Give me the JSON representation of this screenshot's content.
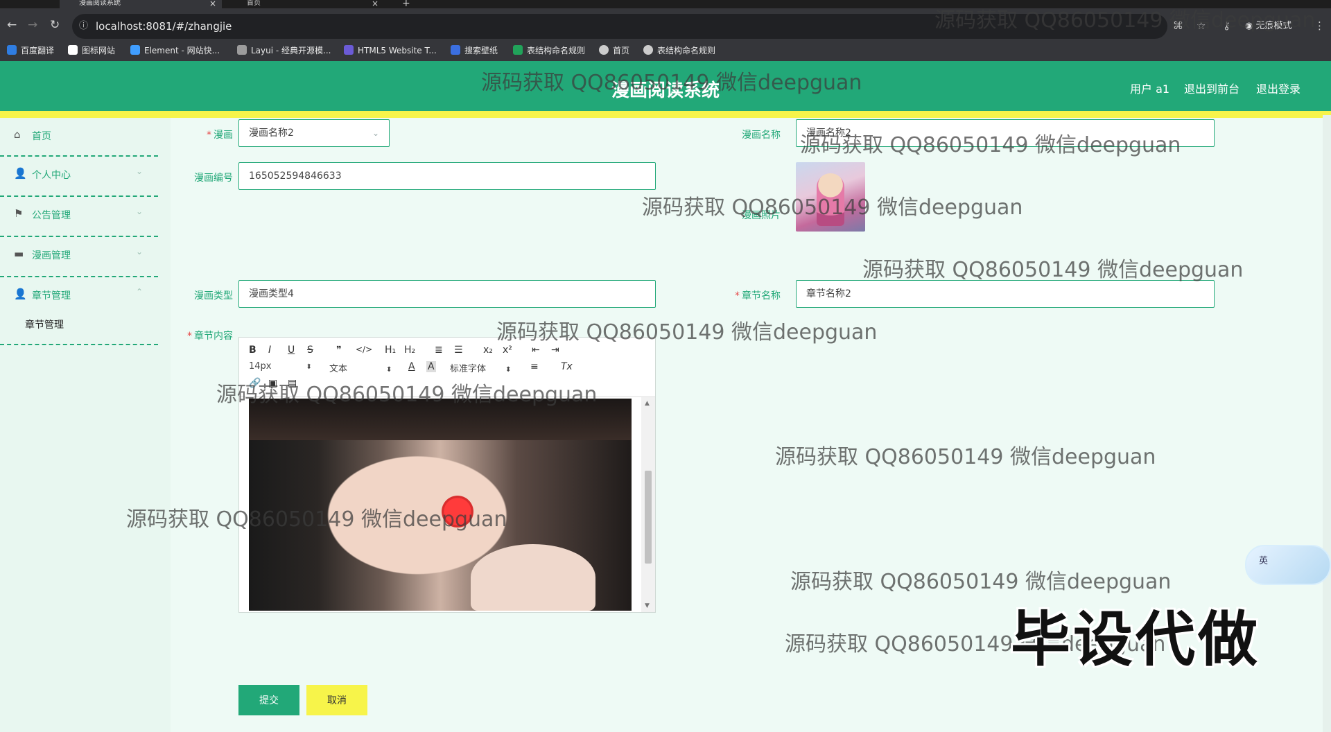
{
  "browser": {
    "tabs": [
      {
        "title": "漫画阅读系统",
        "active": true
      },
      {
        "title": "首页",
        "active": false
      }
    ],
    "url": "localhost:8081/#/zhangjie",
    "incognito_label": "无痕模式",
    "bookmarks": [
      {
        "label": "百度翻译",
        "color": "#2f7de1"
      },
      {
        "label": "图标网站",
        "color": "#ffffff"
      },
      {
        "label": "Element - 网站快...",
        "color": "#409eff"
      },
      {
        "label": "Layui - 经典开源模...",
        "color": "#9c9c9c"
      },
      {
        "label": "HTML5 Website T...",
        "color": "#6b5bd6"
      },
      {
        "label": "搜索壁纸",
        "color": "#3b6fe0"
      },
      {
        "label": "表结构命名规则",
        "color": "#21a35a"
      },
      {
        "label": "首页",
        "color": "#cccccc"
      },
      {
        "label": "表结构命名规则",
        "color": "#cccccc"
      }
    ]
  },
  "header": {
    "title": "漫画阅读系统",
    "user": "用户 a1",
    "to_front": "退出到前台",
    "logout": "退出登录",
    "color": "#22a878",
    "accent": "#f7f44a"
  },
  "sidebar": {
    "items": [
      {
        "label": "首页",
        "icon": "home-icon"
      },
      {
        "label": "个人中心",
        "icon": "user-icon"
      },
      {
        "label": "公告管理",
        "icon": "flag-icon"
      },
      {
        "label": "漫画管理",
        "icon": "book-icon"
      },
      {
        "label": "章节管理",
        "icon": "user-icon",
        "expanded": true
      }
    ],
    "sub_item": "章节管理"
  },
  "form": {
    "manhua_label": "漫画",
    "manhua_value": "漫画名称2",
    "name_label": "漫画名称",
    "name_value": "漫画名称2",
    "number_label": "漫画编号",
    "number_value": "165052594846633",
    "photo_label": "漫画照片",
    "type_label": "漫画类型",
    "type_value": "漫画类型4",
    "chapter_name_label": "章节名称",
    "chapter_name_value": "章节名称2",
    "content_label": "章节内容",
    "submit": "提交",
    "cancel": "取消"
  },
  "editor": {
    "font_size": "14px",
    "text_style": "文本",
    "font_family": "标准字体",
    "toolbar_row1": [
      "B",
      "I",
      "U",
      "S",
      "❞",
      "</>",
      "H₁",
      "H₂",
      "≣",
      "☰",
      "x₂",
      "x²",
      "⇤",
      "⇥"
    ]
  },
  "overlay": {
    "watermark": "源码获取 QQ86050149 微信deepguan",
    "promo": "毕设代做",
    "ime": "英"
  }
}
